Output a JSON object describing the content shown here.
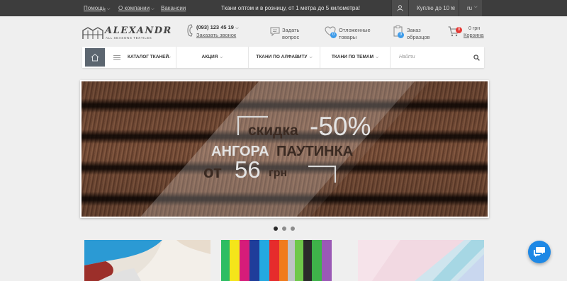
{
  "topbar": {
    "help_label": "Помощь",
    "about_label": "О компании",
    "vacancies_label": "Вакансии",
    "promo": "Ткани оптом и в розницу, от 1 метра до 5 километра!",
    "buy_label": "Куплю до 10 м",
    "lang": "ru"
  },
  "logo": {
    "brand": "ALEXANDR",
    "tagline": "ALL SEASONS TEXTILES"
  },
  "header": {
    "phone": "(093) 123 45 19",
    "callback": "Заказать звонок",
    "ask_line1": "Задать",
    "ask_line2": "вопрос",
    "deferred_line1": "Отложенные",
    "deferred_line2": "товары",
    "deferred_count": "0",
    "samples_line1": "Заказ",
    "samples_line2": "образцов",
    "samples_count": "0",
    "cart_count": "0",
    "cart_sum": "0 грн",
    "cart_label": "Корзина"
  },
  "nav": {
    "catalog": "КАТАЛОГ ТКАНЕЙ",
    "sale": "АКЦИЯ",
    "alphabet": "ТКАНИ ПО АЛФАВИТУ",
    "themes": "ТКАНИ ПО ТЕМАМ",
    "search_placeholder": "Найти"
  },
  "banner": {
    "discount_word": "скидка",
    "discount_value": "-50%",
    "fabric_1": "АНГОРА",
    "fabric_2": "ПАУТИНКА",
    "from_word": "от",
    "price": "56",
    "currency": "грн"
  },
  "slider": {
    "dots": 3,
    "active": 0
  },
  "colors": {
    "topbar": "#3d3d3d",
    "accent_blue": "#1e88e5",
    "badge_red": "#e53935",
    "badge_blue": "#3d9be9",
    "banner_text_light": "#e4e4e4",
    "banner_text_dark": "#3a2a22"
  }
}
